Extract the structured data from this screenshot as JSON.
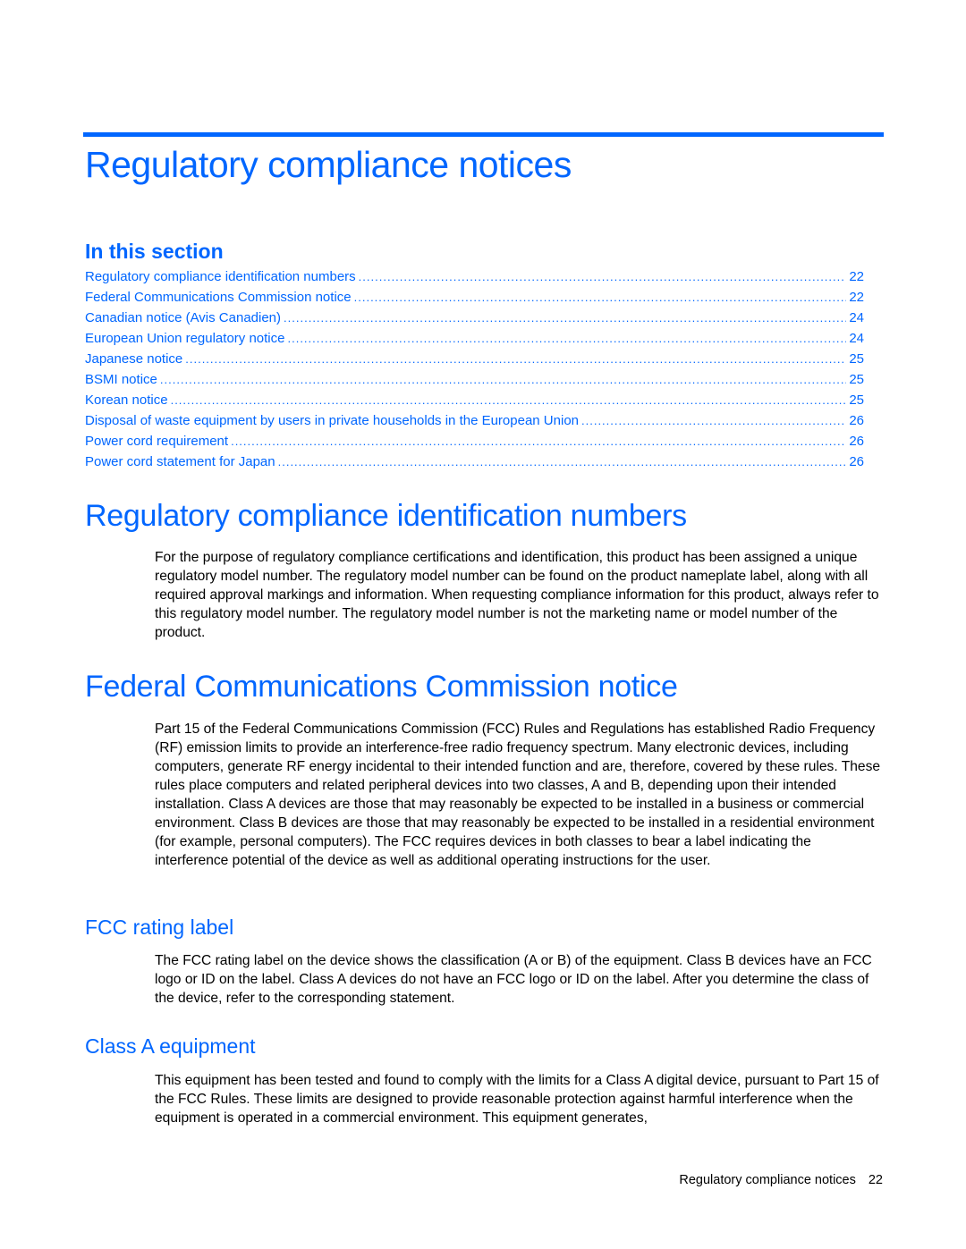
{
  "colors": {
    "accent": "#0066ff",
    "text": "#000000"
  },
  "title": "Regulatory compliance notices",
  "toc": {
    "heading": "In this section",
    "entries": [
      {
        "label": "Regulatory compliance identification numbers",
        "page": "22"
      },
      {
        "label": "Federal Communications Commission notice",
        "page": "22"
      },
      {
        "label": "Canadian notice (Avis Canadien)",
        "page": "24"
      },
      {
        "label": "European Union regulatory notice",
        "page": "24"
      },
      {
        "label": "Japanese notice",
        "page": "25"
      },
      {
        "label": "BSMI notice",
        "page": "25"
      },
      {
        "label": "Korean notice",
        "page": "25"
      },
      {
        "label": "Disposal of waste equipment by users in private households in the European Union",
        "page": "26"
      },
      {
        "label": "Power cord requirement",
        "page": "26"
      },
      {
        "label": "Power cord statement for Japan",
        "page": "26"
      }
    ]
  },
  "sections": {
    "id_numbers": {
      "heading": "Regulatory compliance identification numbers",
      "body": "For the purpose of regulatory compliance certifications and identification, this product has been assigned a unique regulatory model number. The regulatory model number can be found on the product nameplate label, along with all required approval markings and information. When requesting compliance information for this product, always refer to this regulatory model number. The regulatory model number is not the marketing name or model number of the product."
    },
    "fcc": {
      "heading": "Federal Communications Commission notice",
      "body": "Part 15 of the Federal Communications Commission (FCC) Rules and Regulations has established Radio Frequency (RF) emission limits to provide an interference-free radio frequency spectrum. Many electronic devices, including computers, generate RF energy incidental to their intended function and are, therefore, covered by these rules. These rules place computers and related peripheral devices into two classes, A and B, depending upon their intended installation. Class A devices are those that may reasonably be expected to be installed in a business or commercial environment. Class B devices are those that may reasonably be expected to be installed in a residential environment (for example, personal computers). The FCC requires devices in both classes to bear a label indicating the interference potential of the device as well as additional operating instructions for the user."
    },
    "fcc_rating": {
      "heading": "FCC rating label",
      "body": "The FCC rating label on the device shows the classification (A or B) of the equipment. Class B devices have an FCC logo or ID on the label. Class A devices do not have an FCC logo or ID on the label. After you determine the class of the device, refer to the corresponding statement."
    },
    "class_a": {
      "heading": "Class A equipment",
      "body": "This equipment has been tested and found to comply with the limits for a Class A digital device, pursuant to Part 15 of the FCC Rules. These limits are designed to provide reasonable protection against harmful interference when the equipment is operated in a commercial environment. This equipment generates,"
    }
  },
  "footer": {
    "chapter": "Regulatory compliance notices",
    "page": "22"
  }
}
